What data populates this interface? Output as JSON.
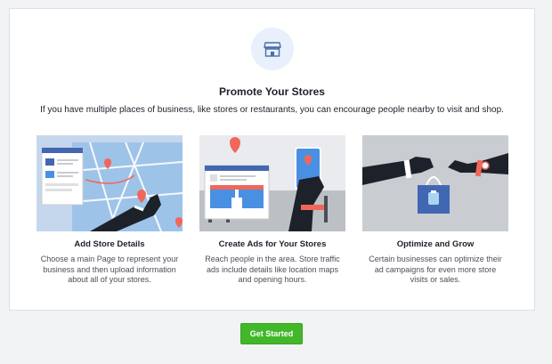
{
  "header": {
    "icon": "store-icon",
    "title": "Promote Your Stores",
    "subtitle": "If you have multiple places of business, like stores or restaurants, you can encourage people nearby to visit and shop."
  },
  "features": [
    {
      "illustration": "map-pin-illustration",
      "title": "Add Store Details",
      "description": "Choose a main Page to represent your business and then upload information about all of your stores."
    },
    {
      "illustration": "storefront-phone-illustration",
      "title": "Create Ads for Your Stores",
      "description": "Reach people in the area. Store traffic ads include details like location maps and opening hours."
    },
    {
      "illustration": "handshake-bag-illustration",
      "title": "Optimize and Grow",
      "description": "Certain businesses can optimize their ad campaigns for even more store visits or sales."
    }
  ],
  "cta": {
    "label": "Get Started"
  },
  "colors": {
    "accent": "#42b72a",
    "brand": "#4267b2",
    "pin": "#f0675a",
    "icon_bg": "#e7f0fb"
  }
}
